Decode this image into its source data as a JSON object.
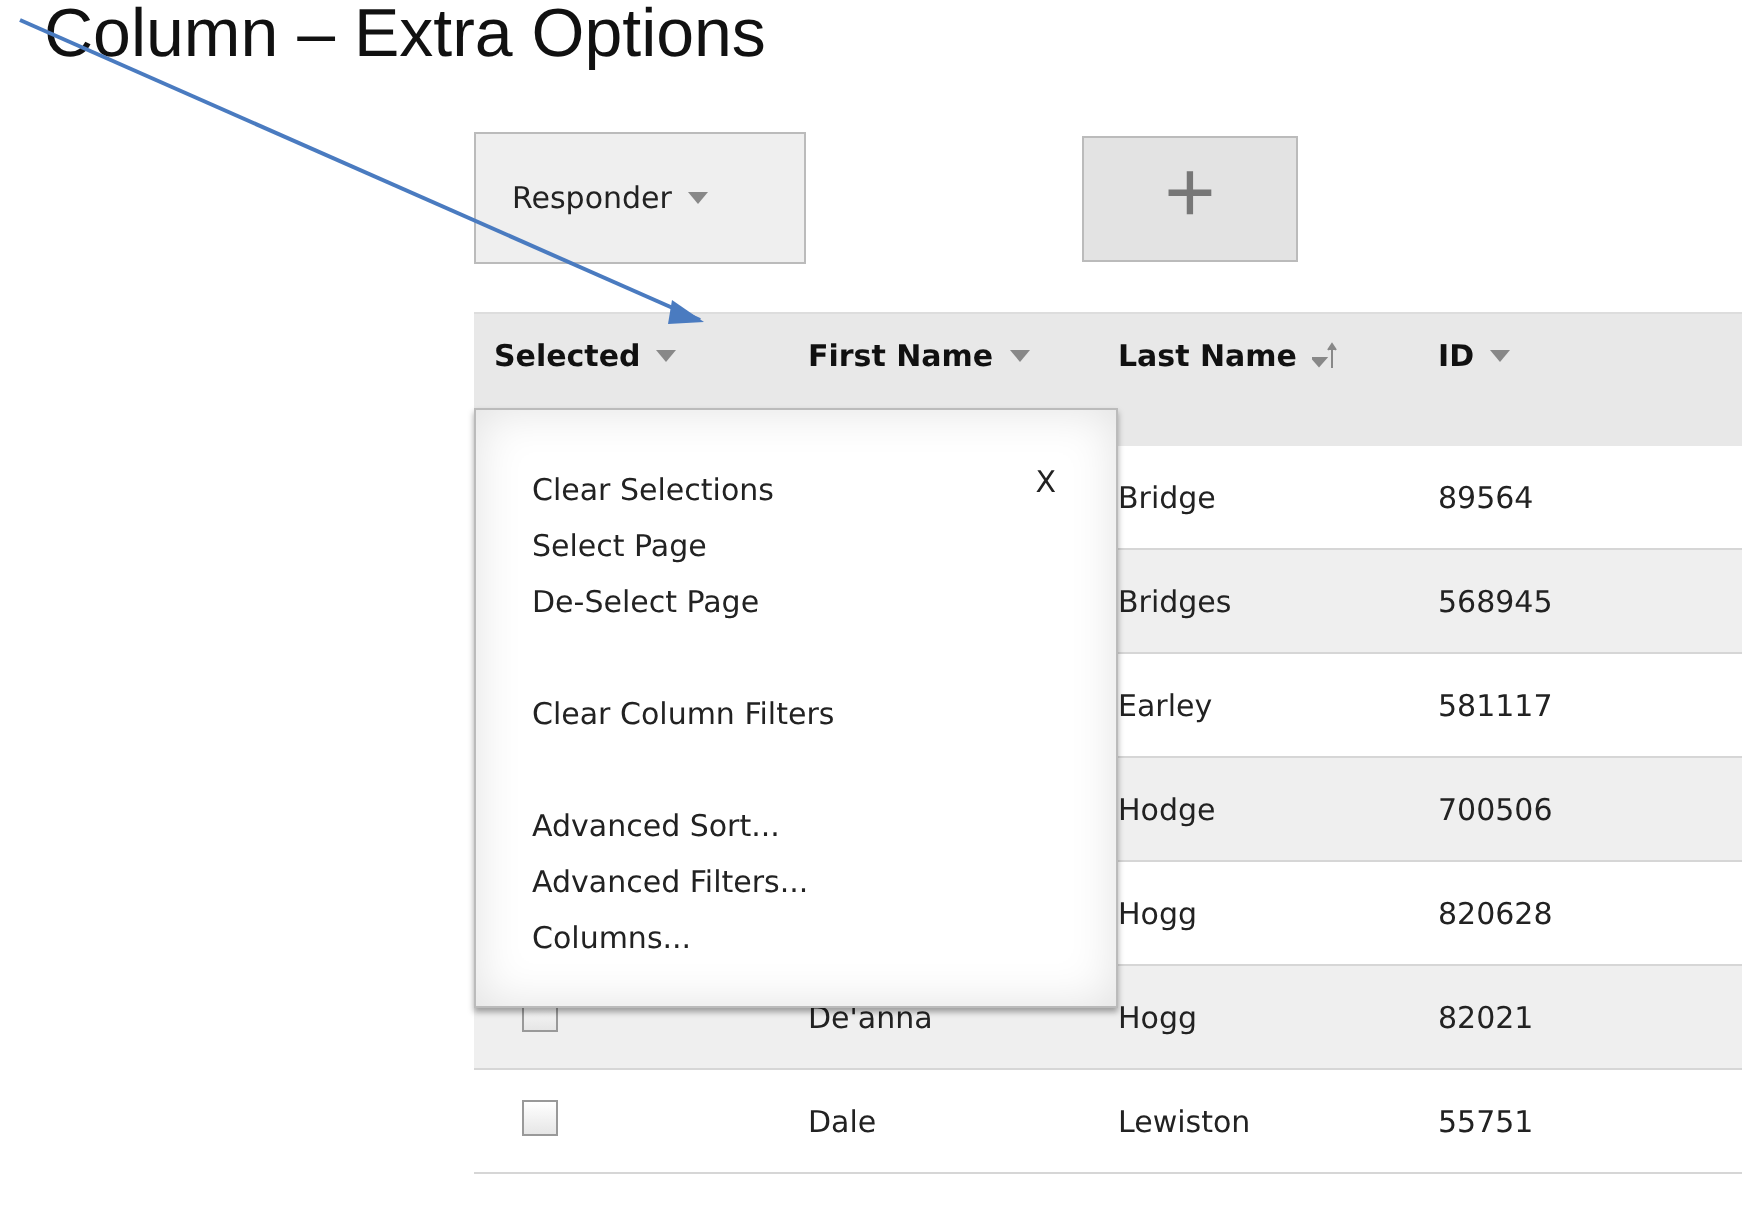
{
  "title": "Column – Extra Options",
  "toolbar": {
    "dropdown": "Responder",
    "add_button": "+"
  },
  "columns": [
    {
      "label": "Selected",
      "sorted": false
    },
    {
      "label": "First Name",
      "sorted": false
    },
    {
      "label": "Last Name",
      "sorted": true
    },
    {
      "label": "ID",
      "sorted": false
    }
  ],
  "rows": [
    {
      "last_name": "Bridge",
      "id": "89564"
    },
    {
      "last_name": "Bridges",
      "id": "568945"
    },
    {
      "last_name": "Earley",
      "id": "581117"
    },
    {
      "last_name": "Hodge",
      "id": "700506"
    },
    {
      "last_name": "Hogg",
      "id": "820628"
    },
    {
      "checked": false,
      "first_name": "De'anna",
      "last_name": "Hogg",
      "id": "82021"
    },
    {
      "checked": false,
      "first_name": "Dale",
      "last_name": "Lewiston",
      "id": "55751"
    }
  ],
  "menu": {
    "close": "X",
    "groups": [
      [
        "Clear Selections",
        "Select Page",
        "De-Select Page"
      ],
      [
        "Clear Column Filters"
      ],
      [
        "Advanced Sort...",
        "Advanced Filters...",
        "Columns..."
      ]
    ]
  }
}
